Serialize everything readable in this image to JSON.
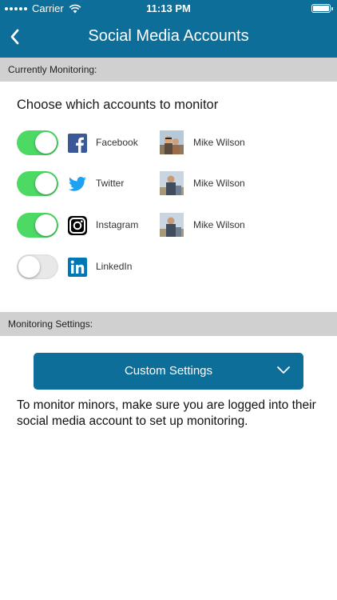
{
  "status_bar": {
    "carrier": "Carrier",
    "time": "11:13 PM"
  },
  "nav": {
    "title": "Social Media Accounts"
  },
  "sections": {
    "monitoring": "Currently Monitoring:",
    "settings": "Monitoring Settings:"
  },
  "prompt": "Choose which accounts to monitor",
  "accounts": [
    {
      "platform": "Facebook",
      "user": "Mike Wilson",
      "enabled": true,
      "icon": "facebook-icon"
    },
    {
      "platform": "Twitter",
      "user": "Mike Wilson",
      "enabled": true,
      "icon": "twitter-icon"
    },
    {
      "platform": "Instagram",
      "user": "Mike Wilson",
      "enabled": true,
      "icon": "instagram-icon"
    },
    {
      "platform": "LinkedIn",
      "user": "",
      "enabled": false,
      "icon": "linkedin-icon"
    }
  ],
  "settings": {
    "selected": "Custom Settings"
  },
  "info": "To monitor minors, make sure you are logged into their social media account to set up monitoring.",
  "colors": {
    "brand": "#0d6e9a",
    "toggle_on": "#4cd964",
    "section_bg": "#d0d0d0",
    "facebook": "#3b5998",
    "twitter": "#1da1f2",
    "instagram": "#000000",
    "linkedin": "#0077b5"
  }
}
